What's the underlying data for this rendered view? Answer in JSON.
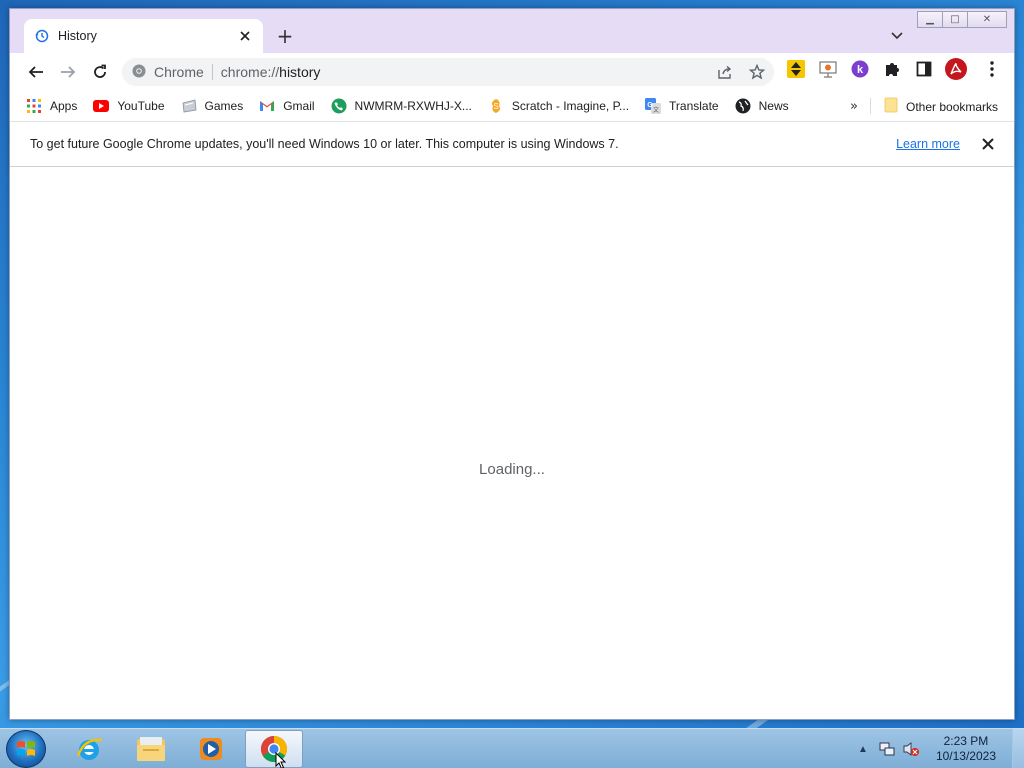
{
  "tab": {
    "title": "History",
    "close_glyph": "✕",
    "icon": "history-icon"
  },
  "new_tab_glyph": "+",
  "window_controls": {
    "minimize": "▁",
    "maximize": "□",
    "close": "✕"
  },
  "toolbar": {
    "back_icon": "arrow-left-icon",
    "forward_icon": "arrow-right-icon",
    "reload_icon": "reload-icon"
  },
  "omnibox": {
    "site_name": "Chrome",
    "url_prefix": "chrome://",
    "url_path": "history"
  },
  "extensions": [
    "yellow-arrows-extension-icon",
    "presentation-extension-icon",
    "k-extension-icon",
    "puzzle-icon",
    "side-panel-icon",
    "acrobat-icon"
  ],
  "bookmarks": [
    {
      "label": "Apps",
      "icon": "apps-grid-icon"
    },
    {
      "label": "YouTube",
      "icon": "youtube-icon"
    },
    {
      "label": "Games",
      "icon": "games-icon"
    },
    {
      "label": "Gmail",
      "icon": "gmail-icon"
    },
    {
      "label": "NWMRM-RXWHJ-X...",
      "icon": "phone-icon"
    },
    {
      "label": "Scratch - Imagine, P...",
      "icon": "scratch-icon"
    },
    {
      "label": "Translate",
      "icon": "translate-icon"
    },
    {
      "label": "News",
      "icon": "globe-icon"
    }
  ],
  "bookmarks_more": "»",
  "other_bookmarks": "Other bookmarks",
  "infobar": {
    "message": "To get future Google Chrome updates, you'll need Windows 10 or later. This computer is using Windows 7.",
    "link": "Learn more"
  },
  "content": {
    "loading_text": "Loading..."
  },
  "taskbar": {
    "apps": [
      "internet-explorer-icon",
      "file-explorer-icon",
      "media-player-icon",
      "chrome-icon"
    ],
    "tray_arrow": "▲",
    "time": "2:23 PM",
    "date": "10/13/2023"
  },
  "colors": {
    "accent": "#1a73e8",
    "tab_strip": "#e6dcf5",
    "omnibox": "#f1f3f4"
  }
}
